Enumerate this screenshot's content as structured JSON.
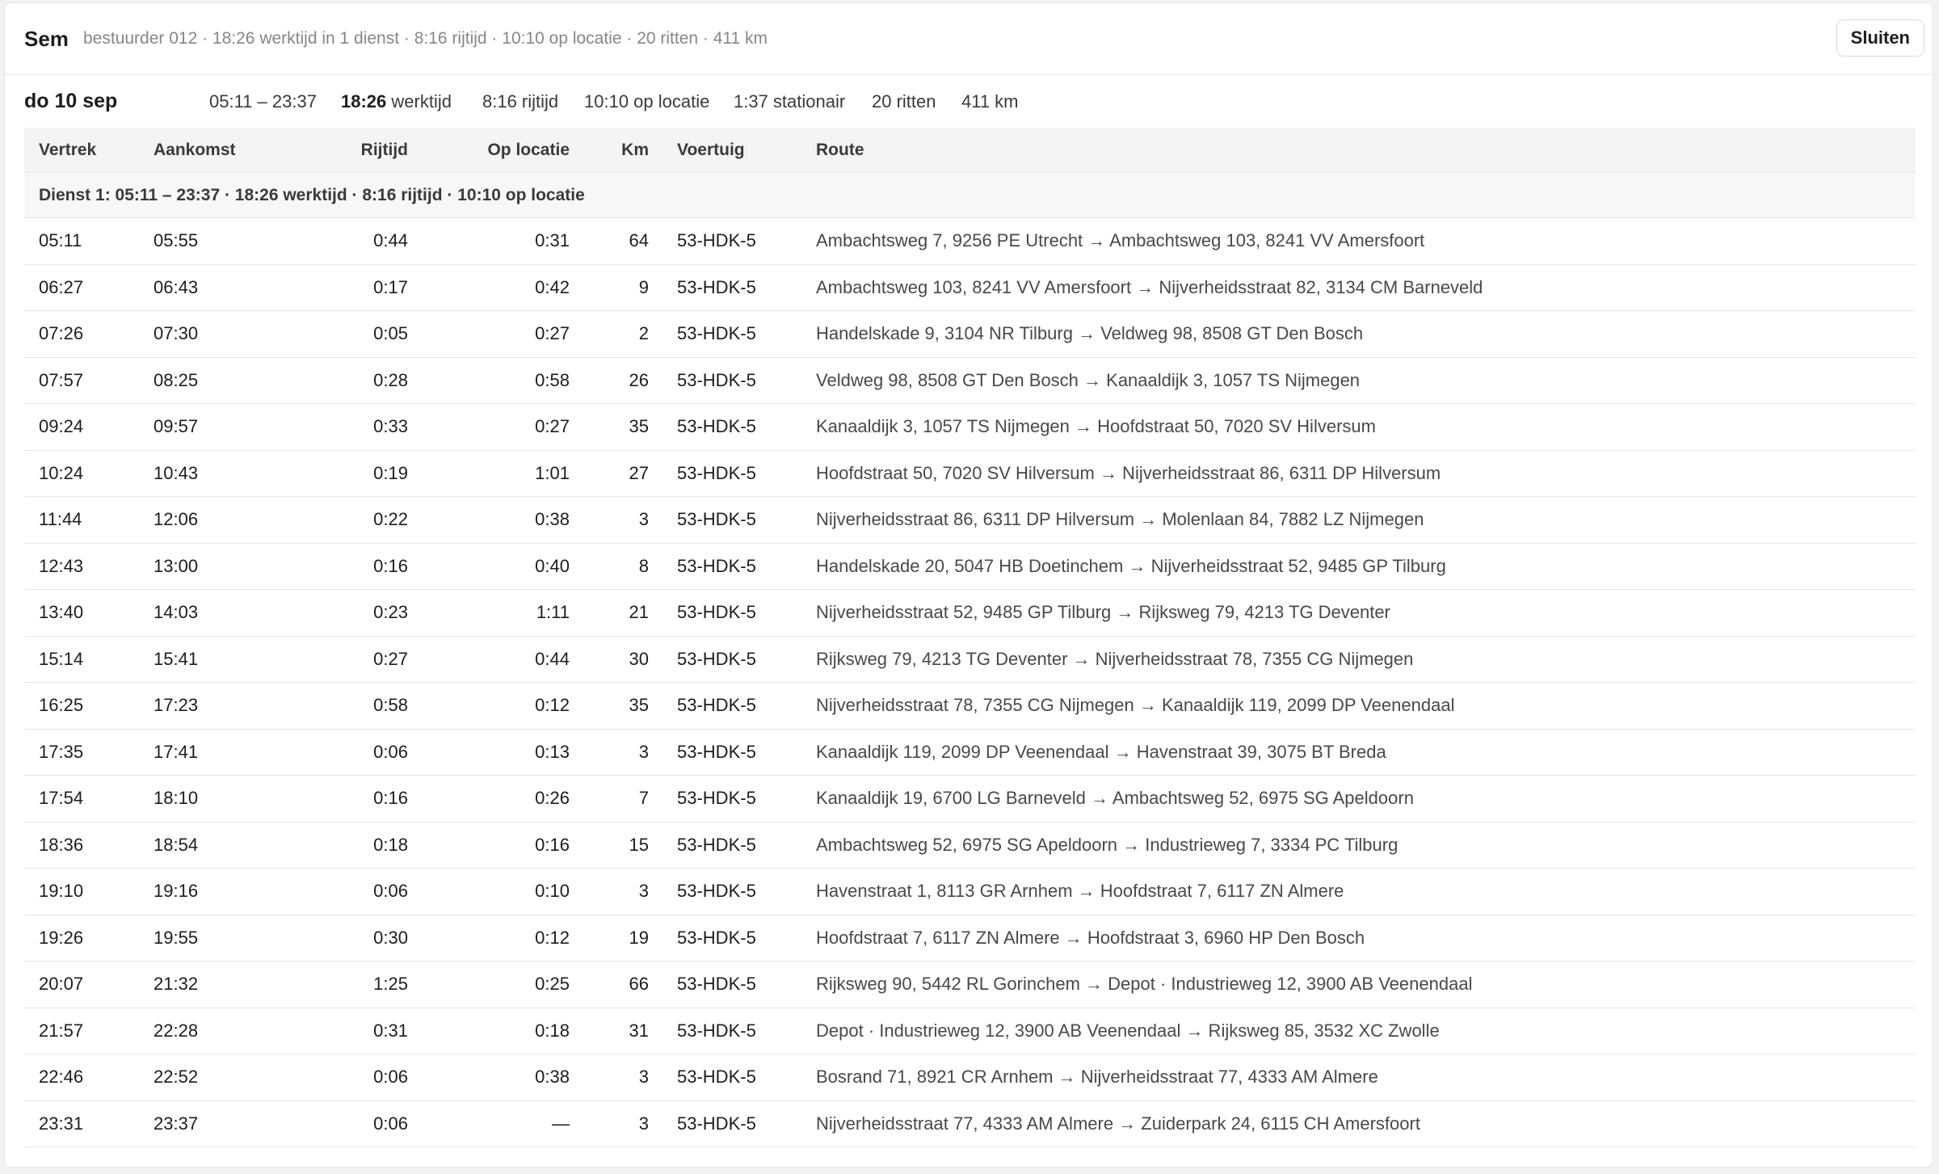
{
  "header": {
    "name": "Sem",
    "summary": "bestuurder 012 · 18:26 werktijd in 1 dienst · 8:16 rijtijd · 10:10 op locatie · 20 ritten · 411 km",
    "close_label": "Sluiten"
  },
  "day": {
    "title": "do 10 sep",
    "range": "05:11 – 23:37",
    "worktime_value": "18:26",
    "worktime_label": "werktijd",
    "drive": "8:16 rijtijd",
    "location": "10:10 op locatie",
    "idle": "1:37 stationair",
    "trips": "20 ritten",
    "km": "411 km"
  },
  "table": {
    "columns": [
      "Vertrek",
      "Aankomst",
      "Rijtijd",
      "Op locatie",
      "Km",
      "Voertuig",
      "Route"
    ],
    "dienst_label": "Dienst 1: 05:11 – 23:37 · 18:26 werktijd · 8:16 rijtijd · 10:10 op locatie",
    "rows": [
      {
        "dep": "05:11",
        "arr": "05:55",
        "drive": "0:44",
        "loc": "0:31",
        "km": "64",
        "vehicle": "53-HDK-5",
        "route": "Ambachtsweg 7, 9256 PE Utrecht → Ambachtsweg 103, 8241 VV Amersfoort"
      },
      {
        "dep": "06:27",
        "arr": "06:43",
        "drive": "0:17",
        "loc": "0:42",
        "km": "9",
        "vehicle": "53-HDK-5",
        "route": "Ambachtsweg 103, 8241 VV Amersfoort → Nijverheidsstraat 82, 3134 CM Barneveld"
      },
      {
        "dep": "07:26",
        "arr": "07:30",
        "drive": "0:05",
        "loc": "0:27",
        "km": "2",
        "vehicle": "53-HDK-5",
        "route": "Handelskade 9, 3104 NR Tilburg → Veldweg 98, 8508 GT Den Bosch"
      },
      {
        "dep": "07:57",
        "arr": "08:25",
        "drive": "0:28",
        "loc": "0:58",
        "km": "26",
        "vehicle": "53-HDK-5",
        "route": "Veldweg 98, 8508 GT Den Bosch → Kanaaldijk 3, 1057 TS Nijmegen"
      },
      {
        "dep": "09:24",
        "arr": "09:57",
        "drive": "0:33",
        "loc": "0:27",
        "km": "35",
        "vehicle": "53-HDK-5",
        "route": "Kanaaldijk 3, 1057 TS Nijmegen → Hoofdstraat 50, 7020 SV Hilversum"
      },
      {
        "dep": "10:24",
        "arr": "10:43",
        "drive": "0:19",
        "loc": "1:01",
        "km": "27",
        "vehicle": "53-HDK-5",
        "route": "Hoofdstraat 50, 7020 SV Hilversum → Nijverheidsstraat 86, 6311 DP Hilversum"
      },
      {
        "dep": "11:44",
        "arr": "12:06",
        "drive": "0:22",
        "loc": "0:38",
        "km": "3",
        "vehicle": "53-HDK-5",
        "route": "Nijverheidsstraat 86, 6311 DP Hilversum → Molenlaan 84, 7882 LZ Nijmegen"
      },
      {
        "dep": "12:43",
        "arr": "13:00",
        "drive": "0:16",
        "loc": "0:40",
        "km": "8",
        "vehicle": "53-HDK-5",
        "route": "Handelskade 20, 5047 HB Doetinchem → Nijverheidsstraat 52, 9485 GP Tilburg"
      },
      {
        "dep": "13:40",
        "arr": "14:03",
        "drive": "0:23",
        "loc": "1:11",
        "km": "21",
        "vehicle": "53-HDK-5",
        "route": "Nijverheidsstraat 52, 9485 GP Tilburg → Rijksweg 79, 4213 TG Deventer"
      },
      {
        "dep": "15:14",
        "arr": "15:41",
        "drive": "0:27",
        "loc": "0:44",
        "km": "30",
        "vehicle": "53-HDK-5",
        "route": "Rijksweg 79, 4213 TG Deventer → Nijverheidsstraat 78, 7355 CG Nijmegen"
      },
      {
        "dep": "16:25",
        "arr": "17:23",
        "drive": "0:58",
        "loc": "0:12",
        "km": "35",
        "vehicle": "53-HDK-5",
        "route": "Nijverheidsstraat 78, 7355 CG Nijmegen → Kanaaldijk 119, 2099 DP Veenendaal"
      },
      {
        "dep": "17:35",
        "arr": "17:41",
        "drive": "0:06",
        "loc": "0:13",
        "km": "3",
        "vehicle": "53-HDK-5",
        "route": "Kanaaldijk 119, 2099 DP Veenendaal → Havenstraat 39, 3075 BT Breda"
      },
      {
        "dep": "17:54",
        "arr": "18:10",
        "drive": "0:16",
        "loc": "0:26",
        "km": "7",
        "vehicle": "53-HDK-5",
        "route": "Kanaaldijk 19, 6700 LG Barneveld → Ambachtsweg 52, 6975 SG Apeldoorn"
      },
      {
        "dep": "18:36",
        "arr": "18:54",
        "drive": "0:18",
        "loc": "0:16",
        "km": "15",
        "vehicle": "53-HDK-5",
        "route": "Ambachtsweg 52, 6975 SG Apeldoorn → Industrieweg 7, 3334 PC Tilburg"
      },
      {
        "dep": "19:10",
        "arr": "19:16",
        "drive": "0:06",
        "loc": "0:10",
        "km": "3",
        "vehicle": "53-HDK-5",
        "route": "Havenstraat 1, 8113 GR Arnhem → Hoofdstraat 7, 6117 ZN Almere"
      },
      {
        "dep": "19:26",
        "arr": "19:55",
        "drive": "0:30",
        "loc": "0:12",
        "km": "19",
        "vehicle": "53-HDK-5",
        "route": "Hoofdstraat 7, 6117 ZN Almere → Hoofdstraat 3, 6960 HP Den Bosch"
      },
      {
        "dep": "20:07",
        "arr": "21:32",
        "drive": "1:25",
        "loc": "0:25",
        "km": "66",
        "vehicle": "53-HDK-5",
        "route": "Rijksweg 90, 5442 RL Gorinchem → Depot · Industrieweg 12, 3900 AB Veenendaal"
      },
      {
        "dep": "21:57",
        "arr": "22:28",
        "drive": "0:31",
        "loc": "0:18",
        "km": "31",
        "vehicle": "53-HDK-5",
        "route": "Depot · Industrieweg 12, 3900 AB Veenendaal → Rijksweg 85, 3532 XC Zwolle"
      },
      {
        "dep": "22:46",
        "arr": "22:52",
        "drive": "0:06",
        "loc": "0:38",
        "km": "3",
        "vehicle": "53-HDK-5",
        "route": "Bosrand 71, 8921 CR Arnhem → Nijverheidsstraat 77, 4333 AM Almere"
      },
      {
        "dep": "23:31",
        "arr": "23:37",
        "drive": "0:06",
        "loc": "—",
        "km": "3",
        "vehicle": "53-HDK-5",
        "route": "Nijverheidsstraat 77, 4333 AM Almere → Zuiderpark 24, 6115 CH Amersfoort"
      }
    ]
  }
}
